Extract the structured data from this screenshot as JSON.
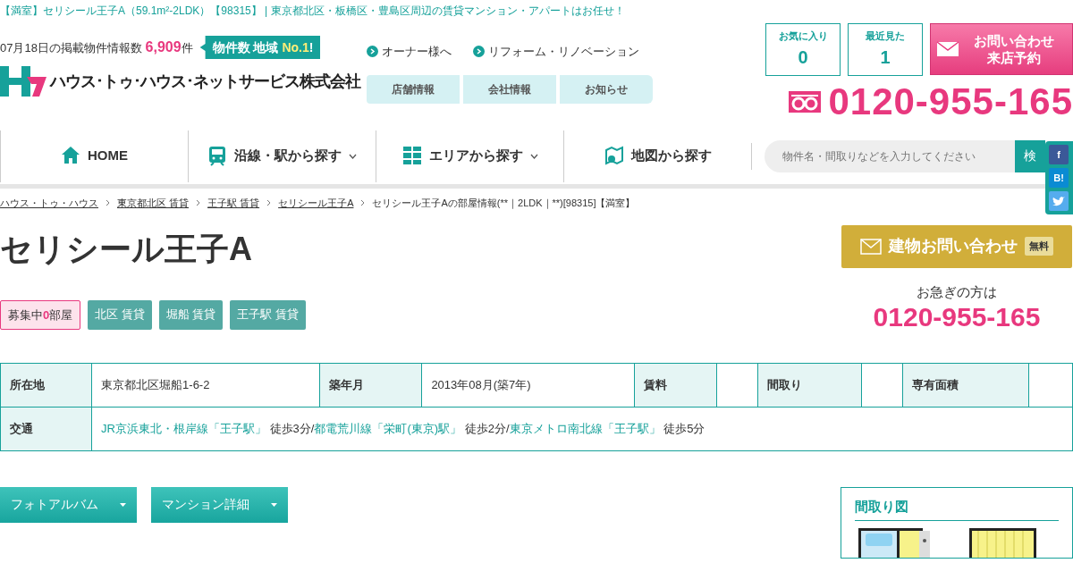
{
  "top_banner": "【満室】セリシール王子A（59.1m²-2LDK）【98315】 | 東京都北区・板橋区・豊島区周辺の賃貸マンション・アパートはお任せ！",
  "header": {
    "count_prefix": "07月18日の掲載物件情報数",
    "count": "6,909",
    "count_suffix": "件",
    "badge_text": "物件数 地域",
    "badge_highlight": "No.1",
    "badge_end": "!",
    "logo_text": "ハウス･トゥ･ハウス･ネットサービス株式会社",
    "links": [
      "オーナー様へ",
      "リフォーム・リノベーション"
    ],
    "sub_nav": [
      "店舗情報",
      "会社情報",
      "お知らせ"
    ],
    "counters": [
      {
        "label": "お気に入り",
        "value": "0"
      },
      {
        "label": "最近見た",
        "value": "1"
      }
    ],
    "contact_button": [
      "お問い合わせ",
      "来店予約"
    ],
    "phone": "0120-955-165"
  },
  "nav": {
    "items": [
      {
        "label": "HOME",
        "kind": "home",
        "dropdown": false
      },
      {
        "label": "沿線・駅から探す",
        "kind": "train",
        "dropdown": true
      },
      {
        "label": "エリアから探す",
        "kind": "area",
        "dropdown": true
      },
      {
        "label": "地図から探す",
        "kind": "map",
        "dropdown": false
      }
    ],
    "search": {
      "placeholder": "物件名・間取りなどを入力してください",
      "button": "検"
    }
  },
  "social": [
    {
      "kind": "facebook",
      "label": "f"
    },
    {
      "kind": "hatena",
      "label": "B!"
    },
    {
      "kind": "twitter"
    }
  ],
  "breadcrumb": [
    {
      "label": "ハウス・トゥ・ハウス",
      "link": true
    },
    {
      "label": "東京都北区 賃貸",
      "link": true
    },
    {
      "label": "王子駅 賃貸",
      "link": true
    },
    {
      "label": "セリシール王子A",
      "link": true
    },
    {
      "label": "セリシール王子Aの部屋情報(**｜2LDK｜**)[98315]【満室】",
      "link": false
    }
  ],
  "title": "セリシール王子A",
  "tags": [
    {
      "kind": "vacancy",
      "prefix": "募集中",
      "count": "0",
      "suffix": "部屋"
    },
    {
      "kind": "area",
      "label": "北区 賃貸"
    },
    {
      "kind": "area",
      "label": "堀船 賃貸"
    },
    {
      "kind": "area",
      "label": "王子駅 賃貸"
    }
  ],
  "inquiry": {
    "label": "建物お問い合わせ",
    "badge": "無料"
  },
  "urgent": {
    "label": "お急ぎの方は",
    "phone": "0120-955-165"
  },
  "table": {
    "row_1": [
      {
        "kind": "head",
        "text": "所在地"
      },
      {
        "kind": "value",
        "text": "東京都北区堀船1-6-2"
      },
      {
        "kind": "head",
        "text": "築年月"
      },
      {
        "kind": "value",
        "text": "2013年08月(築7年)"
      },
      {
        "kind": "head",
        "text": "賃料"
      },
      {
        "kind": "value"
      },
      {
        "kind": "head",
        "text": "間取り"
      },
      {
        "kind": "value"
      },
      {
        "kind": "head",
        "text": "専有面積"
      },
      {
        "kind": "value"
      }
    ],
    "row_2": {
      "head": "交通",
      "segments": [
        {
          "link": "JR京浜東北・根岸線「王子駅」",
          "text": " 徒歩3分/"
        },
        {
          "link": "都電荒川線「栄町(東京)駅」",
          "text": " 徒歩2分/"
        },
        {
          "link": "東京メトロ南北線「王子駅」",
          "text": " 徒歩5分"
        }
      ]
    }
  },
  "section_buttons": [
    "フォトアルバム",
    "マンション詳細"
  ],
  "floorplan": {
    "title": "間取り図"
  }
}
